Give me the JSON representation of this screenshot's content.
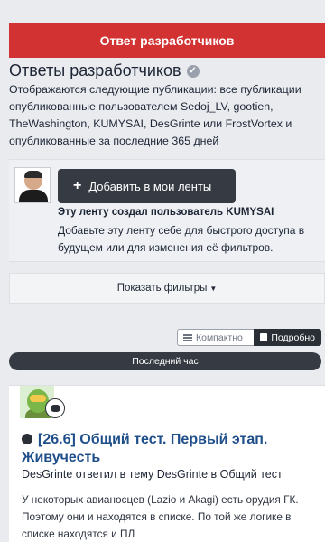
{
  "banner": {
    "label": "Ответ разработчиков"
  },
  "page": {
    "title": "Ответы разработчиков",
    "description": "Отображаются следующие публикации: все публикации опубликованные пользователем Sedoj_LV, gootien, TheWashington, KUMYSAI, DesGrinte или FrostVortex и опубликованные за последние 365 дней"
  },
  "feed": {
    "add_label": "Добавить в мои ленты",
    "creator": "Эту ленту создал пользователь KUMYSAI",
    "hint": "Добавьте эту ленту себе для быстрого доступа в будущем или для изменения её фильтров."
  },
  "filters": {
    "label": "Показать фильтры"
  },
  "view": {
    "compact": "Компактно",
    "detailed": "Подробно",
    "selected": "Подробно"
  },
  "timeline": {
    "label": "Последний час"
  },
  "post": {
    "title": "[26.6] Общий тест. Первый этап. Живучесть",
    "meta": "DesGrinte ответил в тему DesGrinte в Общий тест",
    "excerpt": "У некоторых авианосцев (Lazio и Akagi) есть орудия ГК. Поэтому они и находятся в списке. По той же логике в списке находятся и ПЛ"
  },
  "colors": {
    "banner": "#d23232",
    "dark": "#363b43",
    "link": "#1f4f8b"
  }
}
